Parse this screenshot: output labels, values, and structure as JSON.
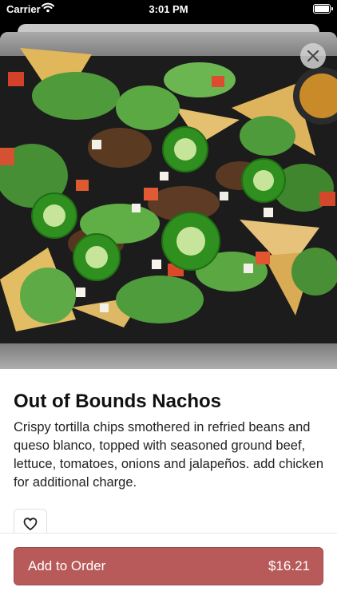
{
  "status_bar": {
    "carrier": "Carrier",
    "time": "3:01 PM"
  },
  "item": {
    "image_description_icon": "food-photo",
    "title": "Out of Bounds Nachos",
    "description": "Crispy tortilla chips smothered in refried beans and queso blanco, topped with seasoned ground beef, lettuce, tomatoes, onions and jalapeños. add chicken for additional charge."
  },
  "actions": {
    "close_icon": "close-icon",
    "favorite_icon": "heart-icon",
    "add_label": "Add to Order",
    "price": "$16.21"
  },
  "colors": {
    "accent": "#b95a5a",
    "hero_tray": "#2a2a2a"
  }
}
